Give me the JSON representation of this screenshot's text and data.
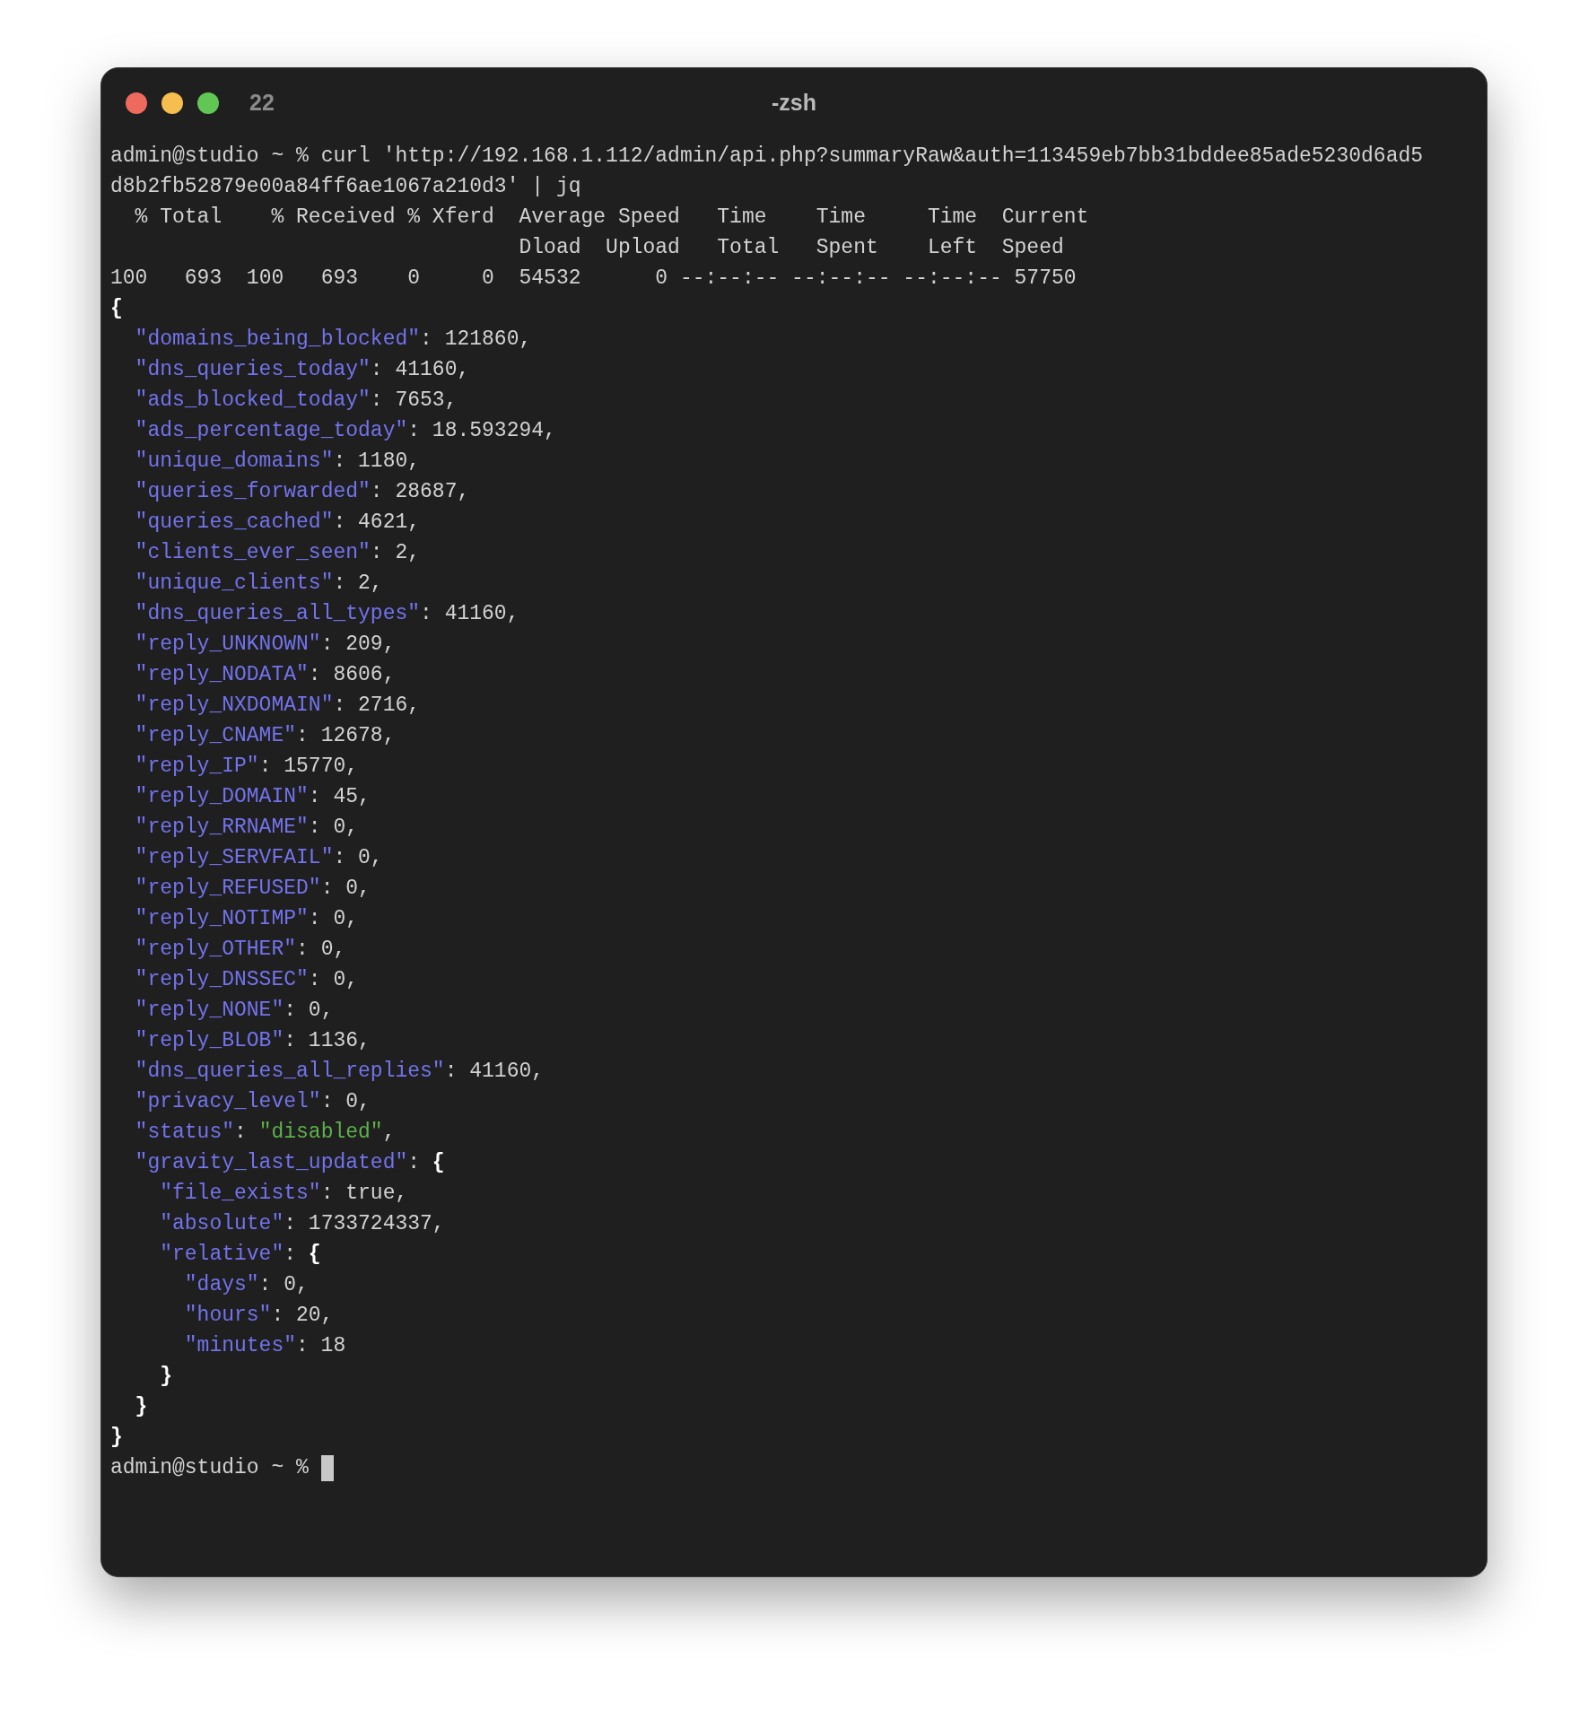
{
  "window": {
    "tab_number": "22",
    "title": "-zsh"
  },
  "command_line": {
    "prompt": "admin@studio ~ %",
    "command": "curl 'http://192.168.1.112/admin/api.php?summaryRaw&auth=113459eb7bb31bddee85ade5230d6ad5d8b2fb52879e00a84ff6ae1067a210d3' | jq"
  },
  "curl_progress": [
    "  % Total    % Received % Xferd  Average Speed   Time    Time     Time  Current",
    "                                 Dload  Upload   Total   Spent    Left  Speed",
    "100   693  100   693    0     0  54532      0 --:--:-- --:--:-- --:--:-- 57750"
  ],
  "json_output": {
    "open": "{",
    "close": "}",
    "entries": [
      {
        "segments": [
          {
            "kind": "key",
            "text": "\"domains_being_blocked\""
          },
          {
            "kind": "plain",
            "text": ": 121860,"
          }
        ]
      },
      {
        "segments": [
          {
            "kind": "key",
            "text": "\"dns_queries_today\""
          },
          {
            "kind": "plain",
            "text": ": 41160,"
          }
        ]
      },
      {
        "segments": [
          {
            "kind": "key",
            "text": "\"ads_blocked_today\""
          },
          {
            "kind": "plain",
            "text": ": 7653,"
          }
        ]
      },
      {
        "segments": [
          {
            "kind": "key",
            "text": "\"ads_percentage_today\""
          },
          {
            "kind": "plain",
            "text": ": 18.593294,"
          }
        ]
      },
      {
        "segments": [
          {
            "kind": "key",
            "text": "\"unique_domains\""
          },
          {
            "kind": "plain",
            "text": ": 1180,"
          }
        ]
      },
      {
        "segments": [
          {
            "kind": "key",
            "text": "\"queries_forwarded\""
          },
          {
            "kind": "plain",
            "text": ": 28687,"
          }
        ]
      },
      {
        "segments": [
          {
            "kind": "key",
            "text": "\"queries_cached\""
          },
          {
            "kind": "plain",
            "text": ": 4621,"
          }
        ]
      },
      {
        "segments": [
          {
            "kind": "key",
            "text": "\"clients_ever_seen\""
          },
          {
            "kind": "plain",
            "text": ": 2,"
          }
        ]
      },
      {
        "segments": [
          {
            "kind": "key",
            "text": "\"unique_clients\""
          },
          {
            "kind": "plain",
            "text": ": 2,"
          }
        ]
      },
      {
        "segments": [
          {
            "kind": "key",
            "text": "\"dns_queries_all_types\""
          },
          {
            "kind": "plain",
            "text": ": 41160,"
          }
        ]
      },
      {
        "segments": [
          {
            "kind": "key",
            "text": "\"reply_UNKNOWN\""
          },
          {
            "kind": "plain",
            "text": ": 209,"
          }
        ]
      },
      {
        "segments": [
          {
            "kind": "key",
            "text": "\"reply_NODATA\""
          },
          {
            "kind": "plain",
            "text": ": 8606,"
          }
        ]
      },
      {
        "segments": [
          {
            "kind": "key",
            "text": "\"reply_NXDOMAIN\""
          },
          {
            "kind": "plain",
            "text": ": 2716,"
          }
        ]
      },
      {
        "segments": [
          {
            "kind": "key",
            "text": "\"reply_CNAME\""
          },
          {
            "kind": "plain",
            "text": ": 12678,"
          }
        ]
      },
      {
        "segments": [
          {
            "kind": "key",
            "text": "\"reply_IP\""
          },
          {
            "kind": "plain",
            "text": ": 15770,"
          }
        ]
      },
      {
        "segments": [
          {
            "kind": "key",
            "text": "\"reply_DOMAIN\""
          },
          {
            "kind": "plain",
            "text": ": 45,"
          }
        ]
      },
      {
        "segments": [
          {
            "kind": "key",
            "text": "\"reply_RRNAME\""
          },
          {
            "kind": "plain",
            "text": ": 0,"
          }
        ]
      },
      {
        "segments": [
          {
            "kind": "key",
            "text": "\"reply_SERVFAIL\""
          },
          {
            "kind": "plain",
            "text": ": 0,"
          }
        ]
      },
      {
        "segments": [
          {
            "kind": "key",
            "text": "\"reply_REFUSED\""
          },
          {
            "kind": "plain",
            "text": ": 0,"
          }
        ]
      },
      {
        "segments": [
          {
            "kind": "key",
            "text": "\"reply_NOTIMP\""
          },
          {
            "kind": "plain",
            "text": ": 0,"
          }
        ]
      },
      {
        "segments": [
          {
            "kind": "key",
            "text": "\"reply_OTHER\""
          },
          {
            "kind": "plain",
            "text": ": 0,"
          }
        ]
      },
      {
        "segments": [
          {
            "kind": "key",
            "text": "\"reply_DNSSEC\""
          },
          {
            "kind": "plain",
            "text": ": 0,"
          }
        ]
      },
      {
        "segments": [
          {
            "kind": "key",
            "text": "\"reply_NONE\""
          },
          {
            "kind": "plain",
            "text": ": 0,"
          }
        ]
      },
      {
        "segments": [
          {
            "kind": "key",
            "text": "\"reply_BLOB\""
          },
          {
            "kind": "plain",
            "text": ": 1136,"
          }
        ]
      },
      {
        "segments": [
          {
            "kind": "key",
            "text": "\"dns_queries_all_replies\""
          },
          {
            "kind": "plain",
            "text": ": 41160,"
          }
        ]
      },
      {
        "segments": [
          {
            "kind": "key",
            "text": "\"privacy_level\""
          },
          {
            "kind": "plain",
            "text": ": 0,"
          }
        ]
      },
      {
        "segments": [
          {
            "kind": "key",
            "text": "\"status\""
          },
          {
            "kind": "plain",
            "text": ": "
          },
          {
            "kind": "string",
            "text": "\"disabled\""
          },
          {
            "kind": "plain",
            "text": ","
          }
        ]
      },
      {
        "segments": [
          {
            "kind": "key",
            "text": "\"gravity_last_updated\""
          },
          {
            "kind": "plain",
            "text": ": "
          },
          {
            "kind": "brace",
            "text": "{"
          }
        ],
        "close": "}",
        "children": [
          {
            "segments": [
              {
                "kind": "key",
                "text": "\"file_exists\""
              },
              {
                "kind": "plain",
                "text": ": true,"
              }
            ]
          },
          {
            "segments": [
              {
                "kind": "key",
                "text": "\"absolute\""
              },
              {
                "kind": "plain",
                "text": ": 1733724337,"
              }
            ]
          },
          {
            "segments": [
              {
                "kind": "key",
                "text": "\"relative\""
              },
              {
                "kind": "plain",
                "text": ": "
              },
              {
                "kind": "brace",
                "text": "{"
              }
            ],
            "close": "}",
            "children": [
              {
                "segments": [
                  {
                    "kind": "key",
                    "text": "\"days\""
                  },
                  {
                    "kind": "plain",
                    "text": ": 0,"
                  }
                ]
              },
              {
                "segments": [
                  {
                    "kind": "key",
                    "text": "\"hours\""
                  },
                  {
                    "kind": "plain",
                    "text": ": 20,"
                  }
                ]
              },
              {
                "segments": [
                  {
                    "kind": "key",
                    "text": "\"minutes\""
                  },
                  {
                    "kind": "plain",
                    "text": ": 18"
                  }
                ]
              }
            ]
          }
        ]
      }
    ]
  },
  "final_prompt": "admin@studio ~ %"
}
